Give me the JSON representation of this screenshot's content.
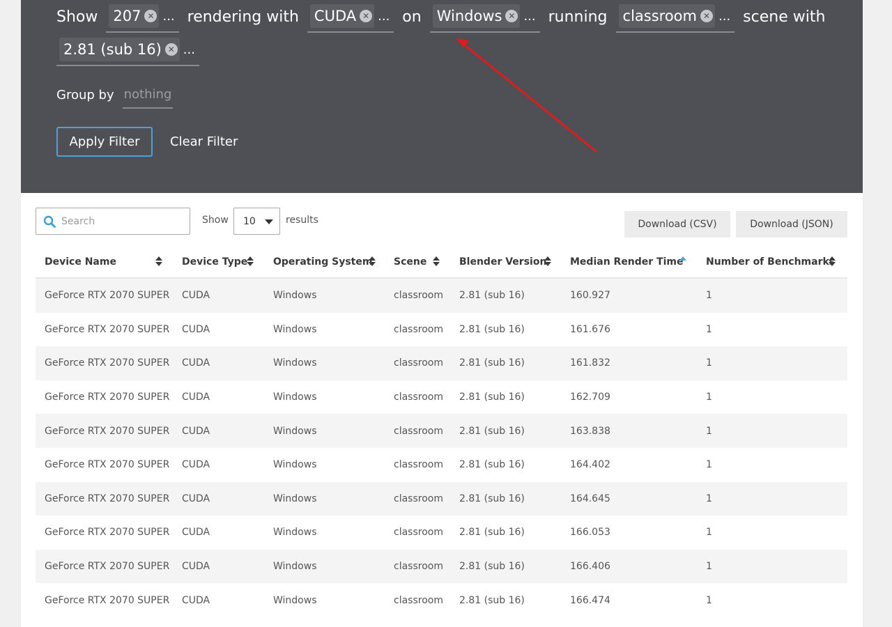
{
  "filter": {
    "words": {
      "show": "Show",
      "rendering_with": "rendering with",
      "on": "on",
      "running": "running",
      "scene_with": "scene with"
    },
    "chips": {
      "device": "207",
      "device_type": "CUDA",
      "os": "Windows",
      "scene": "classroom",
      "version": "2.81 (sub 16)"
    },
    "ellipsis": "...",
    "group_by_label": "Group by",
    "group_by_value": "nothing",
    "apply_label": "Apply Filter",
    "clear_label": "Clear Filter"
  },
  "controls": {
    "search_placeholder": "Search",
    "show_label": "Show",
    "page_size": "10",
    "results_label": "results",
    "download_csv": "Download (CSV)",
    "download_json": "Download (JSON)"
  },
  "colors": {
    "panel_bg": "#4f5056",
    "accent": "#4aa3df",
    "annotation_arrow": "#e01b1b"
  },
  "table": {
    "sorted_column": "Median Render Time",
    "sort_direction": "ascending",
    "columns": [
      "Device Name",
      "Device Type",
      "Operating System",
      "Scene",
      "Blender Version",
      "Median Render Time",
      "Number of Benchmarks"
    ],
    "rows": [
      [
        "GeForce RTX 2070 SUPER",
        "CUDA",
        "Windows",
        "classroom",
        "2.81 (sub 16)",
        "160.927",
        "1"
      ],
      [
        "GeForce RTX 2070 SUPER",
        "CUDA",
        "Windows",
        "classroom",
        "2.81 (sub 16)",
        "161.676",
        "1"
      ],
      [
        "GeForce RTX 2070 SUPER",
        "CUDA",
        "Windows",
        "classroom",
        "2.81 (sub 16)",
        "161.832",
        "1"
      ],
      [
        "GeForce RTX 2070 SUPER",
        "CUDA",
        "Windows",
        "classroom",
        "2.81 (sub 16)",
        "162.709",
        "1"
      ],
      [
        "GeForce RTX 2070 SUPER",
        "CUDA",
        "Windows",
        "classroom",
        "2.81 (sub 16)",
        "163.838",
        "1"
      ],
      [
        "GeForce RTX 2070 SUPER",
        "CUDA",
        "Windows",
        "classroom",
        "2.81 (sub 16)",
        "164.402",
        "1"
      ],
      [
        "GeForce RTX 2070 SUPER",
        "CUDA",
        "Windows",
        "classroom",
        "2.81 (sub 16)",
        "164.645",
        "1"
      ],
      [
        "GeForce RTX 2070 SUPER",
        "CUDA",
        "Windows",
        "classroom",
        "2.81 (sub 16)",
        "166.053",
        "1"
      ],
      [
        "GeForce RTX 2070 SUPER",
        "CUDA",
        "Windows",
        "classroom",
        "2.81 (sub 16)",
        "166.406",
        "1"
      ],
      [
        "GeForce RTX 2070 SUPER",
        "CUDA",
        "Windows",
        "classroom",
        "2.81 (sub 16)",
        "166.474",
        "1"
      ]
    ]
  }
}
